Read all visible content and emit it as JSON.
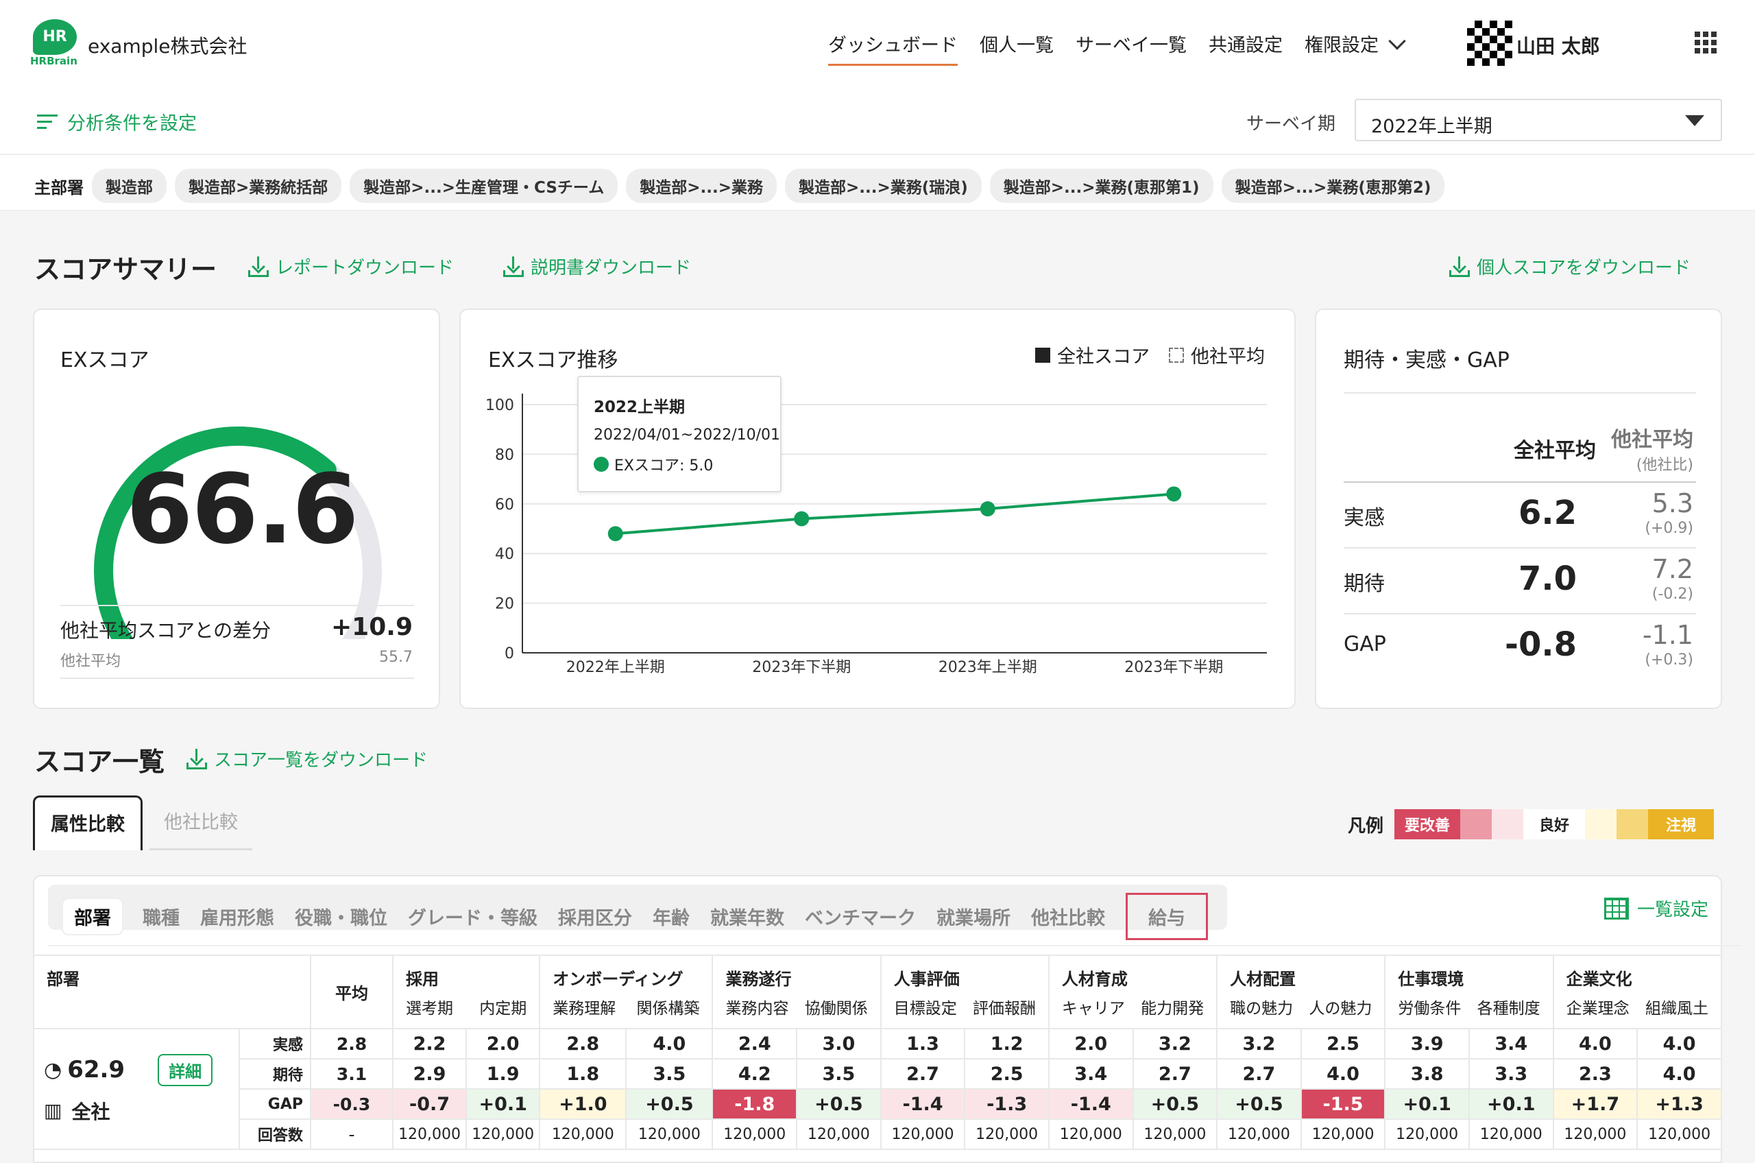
{
  "header": {
    "logo_text": "HR",
    "logo_sub": "HRBrain",
    "company": "example株式会社",
    "nav": [
      "ダッシュボード",
      "個人一覧",
      "サーベイ一覧",
      "共通設定",
      "権限設定"
    ],
    "user_name": "山田 太郎"
  },
  "toolbar": {
    "filter_label": "分析条件を設定",
    "survey_label": "サーベイ期",
    "survey_value": "2022年上半期"
  },
  "dept_bar": {
    "label": "主部署",
    "chips": [
      "製造部",
      "製造部>業務統括部",
      "製造部>...>生産管理・CSチーム",
      "製造部>...>業務",
      "製造部>...>業務(瑞浪)",
      "製造部>...>業務(恵那第1)",
      "製造部>...>業務(恵那第2)"
    ]
  },
  "summary": {
    "title": "スコアサマリー",
    "report_dl": "レポートダウンロード",
    "manual_dl": "説明書ダウンロード",
    "personal_dl": "個人スコアをダウンロード"
  },
  "ex_card": {
    "title": "EXスコア",
    "score": "66.6",
    "gauge_value": 66.6,
    "diff_label": "他社平均スコアとの差分",
    "diff_value": "+10.9",
    "avg_label": "他社平均",
    "avg_value": "55.7"
  },
  "trend_card": {
    "title": "EXスコア推移",
    "legend_company": "全社スコア",
    "legend_other": "他社平均",
    "tooltip_title": "2022上半期",
    "tooltip_range": "2022/04/01~2022/10/01",
    "tooltip_value": "EXスコア: 5.0"
  },
  "chart_data": {
    "type": "line",
    "title": "EXスコア推移",
    "categories": [
      "2022年上半期",
      "2023年下半期",
      "2023年上半期",
      "2023年下半期"
    ],
    "series": [
      {
        "name": "全社スコア",
        "values": [
          48,
          54,
          58,
          64
        ]
      }
    ],
    "yticks": [
      "0",
      "20",
      "40",
      "60",
      "80",
      "100"
    ],
    "ylim": [
      0,
      100
    ],
    "line_color": "#0f9d58"
  },
  "gap_card": {
    "title": "期待・実感・GAP",
    "col_company": "全社平均",
    "col_other": "他社平均",
    "col_other_sub": "(他社比)",
    "rows": [
      {
        "label": "実感",
        "value": "6.2",
        "other": "5.3",
        "diff": "(+0.9)"
      },
      {
        "label": "期待",
        "value": "7.0",
        "other": "7.2",
        "diff": "(-0.2)"
      },
      {
        "label": "GAP",
        "value": "-0.8",
        "other": "-1.1",
        "diff": "(+0.3)"
      }
    ]
  },
  "score_list": {
    "title": "スコア一覧",
    "download": "スコア一覧をダウンロード",
    "tab_attr": "属性比較",
    "tab_other": "他社比較",
    "legend_label": "凡例",
    "legend_bad": "要改善",
    "legend_good": "良好",
    "legend_watch": "注視",
    "segments": [
      "部署",
      "職種",
      "雇用形態",
      "役職・職位",
      "グレード・等級",
      "採用区分",
      "年齢",
      "就業年数",
      "ベンチマーク",
      "就業場所",
      "他社比較",
      "給与"
    ],
    "list_setting": "一覧設定"
  },
  "table": {
    "dept_header": "部署",
    "avg_header": "平均",
    "groups": [
      {
        "name": "採用",
        "subs": [
          "選考期",
          "内定期"
        ]
      },
      {
        "name": "オンボーディング",
        "subs": [
          "業務理解",
          "関係構築"
        ]
      },
      {
        "name": "業務遂行",
        "subs": [
          "業務内容",
          "協働関係"
        ]
      },
      {
        "name": "人事評価",
        "subs": [
          "目標設定",
          "評価報酬"
        ]
      },
      {
        "name": "人材育成",
        "subs": [
          "キャリア",
          "能力開発"
        ]
      },
      {
        "name": "人材配置",
        "subs": [
          "職の魅力",
          "人の魅力"
        ]
      },
      {
        "name": "仕事環境",
        "subs": [
          "労働条件",
          "各種制度"
        ]
      },
      {
        "name": "企業文化",
        "subs": [
          "企業理念",
          "組織風土"
        ]
      }
    ],
    "row_score": "62.9",
    "row_detail": "詳細",
    "row_name": "全社",
    "row_labels": [
      "実感",
      "期待",
      "GAP",
      "回答数"
    ],
    "avg_values": [
      "2.8",
      "3.1",
      "-0.3",
      "-"
    ],
    "jikkan": [
      "2.2",
      "2.0",
      "2.8",
      "4.0",
      "2.4",
      "3.0",
      "1.3",
      "1.2",
      "2.0",
      "3.2",
      "3.2",
      "2.5",
      "3.9",
      "3.4",
      "4.0",
      "4.0"
    ],
    "kitai": [
      "2.9",
      "1.9",
      "1.8",
      "3.5",
      "4.2",
      "3.5",
      "2.7",
      "2.5",
      "3.4",
      "2.7",
      "2.7",
      "4.0",
      "3.8",
      "3.3",
      "2.3",
      "4.0"
    ],
    "gap": [
      "-0.7",
      "+0.1",
      "+1.0",
      "+0.5",
      "-1.8",
      "+0.5",
      "-1.4",
      "-1.3",
      "-1.4",
      "+0.5",
      "+0.5",
      "-1.5",
      "+0.1",
      "+0.1",
      "+1.7",
      "+1.3"
    ],
    "answers": [
      "120,000",
      "120,000",
      "120,000",
      "120,000",
      "120,000",
      "120,000",
      "120,000",
      "120,000",
      "120,000",
      "120,000",
      "120,000",
      "120,000",
      "120,000",
      "120,000",
      "120,000",
      "120,000"
    ]
  }
}
